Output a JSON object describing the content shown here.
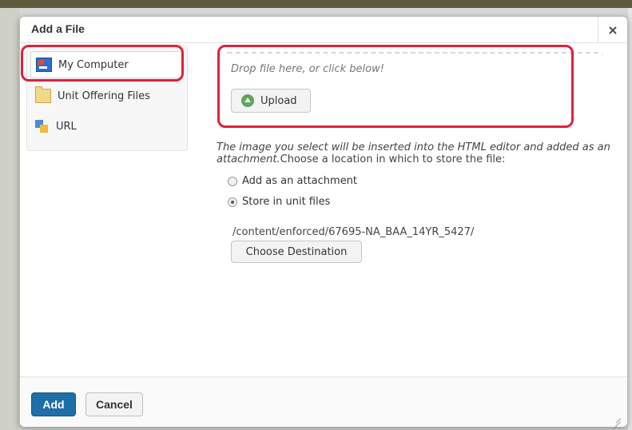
{
  "dialog": {
    "title": "Add a File",
    "close_label": "×"
  },
  "sources": {
    "items": [
      {
        "label": "My Computer",
        "icon": "computer-icon",
        "selected": true
      },
      {
        "label": "Unit Offering Files",
        "icon": "folder-icon",
        "selected": false
      },
      {
        "label": "URL",
        "icon": "url-icon",
        "selected": false
      }
    ]
  },
  "upload": {
    "drop_text": "Drop file here, or click below!",
    "button_label": "Upload",
    "icon": "upload-arrow-icon"
  },
  "description": {
    "italic": "The image you select will be inserted into the HTML editor and added as an attachment.",
    "normal": "Choose a location in which to store the file:"
  },
  "storage": {
    "options": [
      {
        "label": "Add as an attachment",
        "checked": false
      },
      {
        "label": "Store in unit files",
        "checked": true
      }
    ],
    "path": "/content/enforced/67695-NA_BAA_14YR_5427/",
    "choose_label": "Choose Destination"
  },
  "footer": {
    "add_label": "Add",
    "cancel_label": "Cancel"
  },
  "colors": {
    "primary_button": "#1e6fa8",
    "highlight_outline": "#e0203a"
  }
}
